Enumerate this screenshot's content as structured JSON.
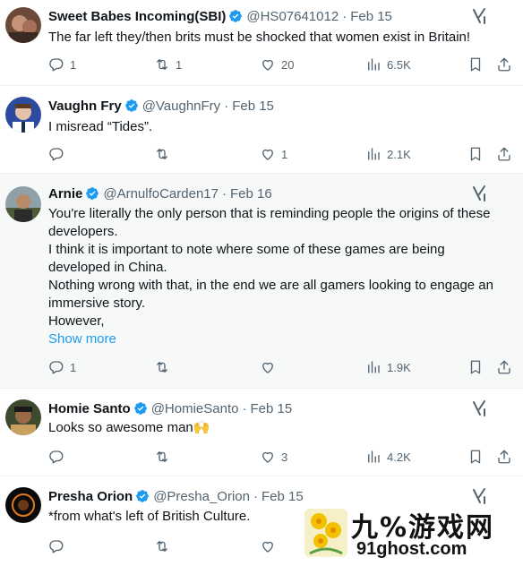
{
  "tweets": [
    {
      "name": "Sweet Babes Incoming(SBI)",
      "handle": "@HS07641012",
      "date": "Feb 15",
      "lines": [
        "The far left they/then brits must be shocked that  women exist in Britain!"
      ],
      "replies": "1",
      "reposts": "1",
      "likes": "20",
      "views": "6.5K",
      "verified": true
    },
    {
      "name": "Vaughn Fry",
      "handle": "@VaughnFry",
      "date": "Feb 15",
      "lines": [
        "I misread “Tides”."
      ],
      "replies": "",
      "reposts": "",
      "likes": "1",
      "views": "2.1K",
      "verified": true
    },
    {
      "name": "Arnie",
      "handle": "@ArnulfoCarden17",
      "date": "Feb 16",
      "lines": [
        "You're literally the only person that is reminding people the origins of these",
        "developers.",
        "I think it is important to note where some of these games are being",
        "developed in China.",
        "Nothing wrong with that, in the end we are all gamers looking to engage an",
        "immersive story.",
        "However,"
      ],
      "show_more": "Show more",
      "replies": "1",
      "reposts": "",
      "likes": "",
      "views": "1.9K",
      "verified": true
    },
    {
      "name": "Homie Santo",
      "handle": "@HomieSanto",
      "date": "Feb 15",
      "lines": [
        "Looks so awesome man🙌"
      ],
      "replies": "",
      "reposts": "",
      "likes": "3",
      "views": "4.2K",
      "verified": true
    },
    {
      "name": "Presha Orion",
      "handle": "@Presha_Orion",
      "date": "Feb 15",
      "lines": [
        "*from what's left of British Culture."
      ],
      "replies": "",
      "reposts": "",
      "likes": "",
      "views": "",
      "verified": true
    }
  ],
  "watermark": {
    "title": "九%游戏网",
    "url": "91ghost.com"
  },
  "colors": {
    "verified": "#1d9bf0",
    "link": "#1d9bf0",
    "muted": "#536471",
    "text": "#0f1419",
    "shaded_bg": "#f7f9f9"
  },
  "icons": [
    "reply-icon",
    "repost-icon",
    "like-icon",
    "views-icon",
    "bookmark-icon",
    "share-icon",
    "grok-icon",
    "verified-badge-icon"
  ]
}
